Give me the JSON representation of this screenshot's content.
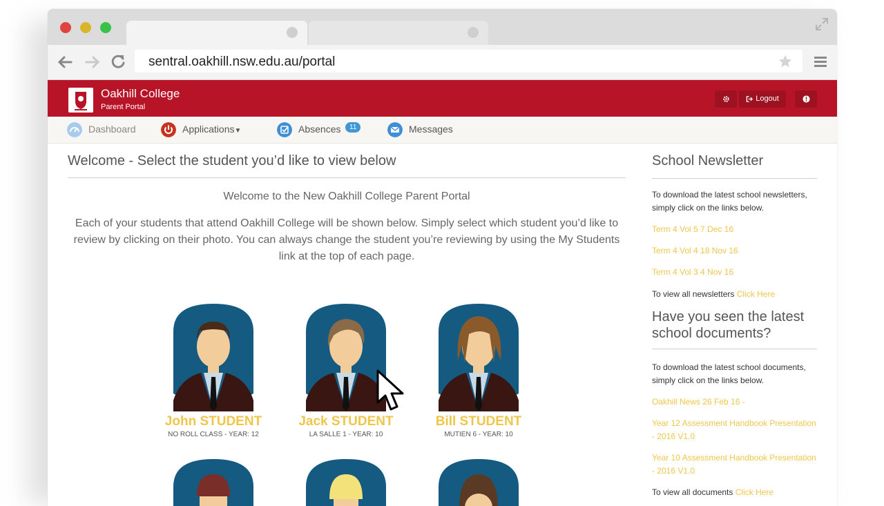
{
  "browser": {
    "url": "sentral.oakhill.nsw.edu.au/portal"
  },
  "header": {
    "school_name": "Oakhill College",
    "subtitle": "Parent Portal",
    "logout_label": "Logout",
    "brand_color": "#b81427"
  },
  "nav": {
    "items": [
      {
        "label": "Dashboard",
        "icon": "dashboard-icon"
      },
      {
        "label": "Applications",
        "icon": "power-icon"
      },
      {
        "label": "Absences",
        "icon": "checkbox-icon",
        "badge": "11"
      },
      {
        "label": "Messages",
        "icon": "envelope-icon"
      }
    ]
  },
  "main": {
    "title": "Welcome - Select the student you’d like to view below",
    "intro_title": "Welcome to the New Oakhill College Parent Portal",
    "intro_body": "Each of your students that attend Oakhill College will be shown below. Simply select which student you’d like to review by clicking on their photo. You can always change the student you’re reviewing by using the My Students link at the top of each page.",
    "students": [
      {
        "name": "John STUDENT",
        "info": "NO ROLL CLASS - YEAR: 12"
      },
      {
        "name": "Jack STUDENT",
        "info": "LA SALLE 1 - YEAR: 10"
      },
      {
        "name": "Bill STUDENT",
        "info": "MUTIEN 6 - YEAR: 10"
      }
    ]
  },
  "sidebar": {
    "newsletter_title": "School Newsletter",
    "newsletter_text": "To download the latest school newsletters, simply click on the links below.",
    "newsletters": [
      "Term 4 Vol 5 7 Dec 16",
      "Term 4 Vol 4 18 Nov 16",
      "Term 4 Vol 3 4 Nov 16"
    ],
    "view_all_newsletters_text": "To view all newsletters",
    "click_here": "Click Here",
    "documents_title": "Have you seen the latest school documents?",
    "documents_text": "To download the latest school documents, simply click on the links below.",
    "documents": [
      "Oakhill News 26 Feb 16 -",
      "Year 12 Assessment Handbook Presentation - 2016 V1.0",
      "Year 10 Assessment Handbook Presentation - 2016 V1.0"
    ],
    "view_all_documents_text": "To view all documents"
  }
}
